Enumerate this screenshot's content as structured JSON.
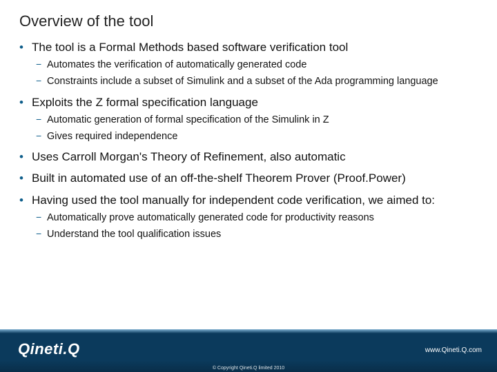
{
  "title": "Overview of the tool",
  "bullets": [
    {
      "level": 1,
      "text": "The tool is a Formal Methods based software verification tool"
    },
    {
      "level": 2,
      "text": "Automates the verification of automatically generated code"
    },
    {
      "level": 2,
      "text": "Constraints include a subset of Simulink and a subset of the Ada programming language"
    },
    {
      "level": 1,
      "text": "Exploits the Z formal specification language"
    },
    {
      "level": 2,
      "text": "Automatic generation of formal specification of the Simulink in Z"
    },
    {
      "level": 2,
      "text": "Gives required independence"
    },
    {
      "level": 1,
      "text": "Uses Carroll Morgan's Theory of Refinement, also automatic"
    },
    {
      "level": 1,
      "text": "Built in automated use of an off-the-shelf Theorem Prover (Proof.Power)"
    },
    {
      "level": 1,
      "text": "Having used the tool manually for independent code verification, we aimed to:"
    },
    {
      "level": 2,
      "text": "Automatically prove automatically generated code for productivity reasons"
    },
    {
      "level": 2,
      "text": "Understand the tool qualification issues"
    }
  ],
  "footer": {
    "logo": "Qineti.Q",
    "url": "www.Qineti.Q.com",
    "copyright": "© Copyright Qineti.Q limited 2010"
  }
}
